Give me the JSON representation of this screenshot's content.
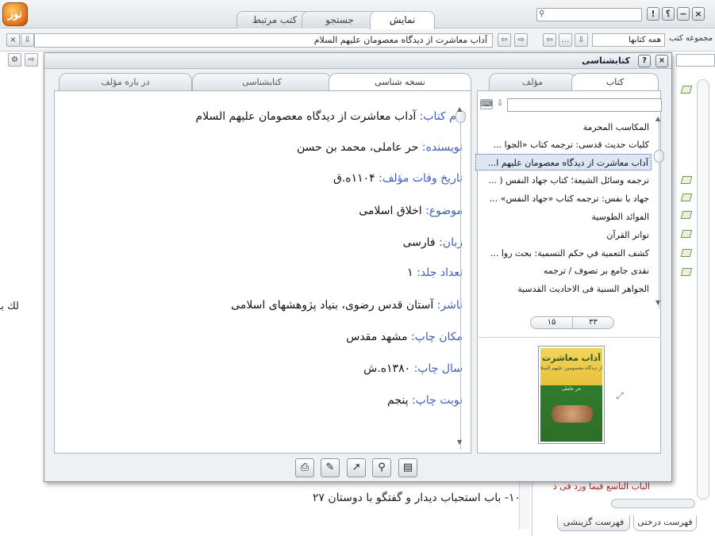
{
  "app": {
    "logo_text": "نور",
    "top_tabs": [
      "نمایش",
      "جستجو",
      "کتب مرتبط"
    ],
    "window_buttons": [
      "×",
      "−",
      "؟",
      "!"
    ],
    "address": "آداب معاشرت از دیدگاه معصومان علیهم السلام",
    "collection_label": "مجموعه کتب",
    "collection_value": "همه کتابها"
  },
  "background": {
    "left_fragment": "لك به",
    "bottom_line": "۱۰- باب استحباب دیدار و گفتگو با دوستان ۲۷",
    "red_line": "الباب التاسع فیما ورد فی ذ",
    "bottom_tabs": [
      "فهرست درختی",
      "فهرست گزینشی"
    ]
  },
  "dialog": {
    "title": "کتابشناسی",
    "content_tabs": [
      "نسخه شناسی",
      "کتابشناسی",
      "در باره مؤلف"
    ],
    "list_tabs": [
      "کتاب",
      "مؤلف"
    ],
    "fields": [
      {
        "label": "نام کتاب:",
        "value": " آداب معاشرت از دیدگاه معصومان علیهم السلام"
      },
      {
        "label": "نویسنده:",
        "value": " حر عاملی، محمد بن حسن"
      },
      {
        "label": "تاریخ وفات مؤلف:",
        "value": " ۱۱۰۴ه.ق"
      },
      {
        "label": "موضوع:",
        "value": " اخلاق اسلامی"
      },
      {
        "label": "زبان:",
        "value": " فارسی"
      },
      {
        "label": "تعداد جلد:",
        "value": " ۱"
      },
      {
        "label": "ناشر:",
        "value": " آستان قدس رضوی، بنیاد پژوهشهای اسلامی"
      },
      {
        "label": "مکان چاپ:",
        "value": " مشهد مقدس"
      },
      {
        "label": "سال چاپ:",
        "value": " ۱۳۸۰ه.ش"
      },
      {
        "label": "نوبت چاپ:",
        "value": " پنجم"
      }
    ],
    "list_items": [
      "المکاسب المحرمة",
      "کلیات حدیث قدسی: ترجمه کتاب «الجوا ...",
      "آداب معاشرت از دیدگاه معصومان علیهم ا...",
      "ترجمه وسائل الشيعة؛ كتاب جهاد النفس ( ...",
      "جهاد با نفس: ترجمه کتاب «جهاد النفس» ...",
      "الفوائد الطوسية",
      "تواتر القرآن",
      "کشف التعمیة في حکم التسمیة: بحث روا ...",
      "نقدی جامع بر تصوف / ترجمه",
      "الجواهر السنیة فی الاحادیث القدسیة"
    ],
    "selected_index": 2,
    "pager_current": "۱۵",
    "pager_total": "۳۳",
    "cover": {
      "title": "آداب معاشرت",
      "subtitle": "از دیدگاه معصومین علیهم السلام",
      "author": "حر عاملی"
    },
    "toolbar_icons": [
      "print-icon",
      "edit-icon",
      "export-icon",
      "search-icon",
      "note-icon"
    ]
  },
  "colors": {
    "label_blue": "#3b5fc0",
    "selection": "#dde6f4",
    "red_text": "#b0241a"
  }
}
